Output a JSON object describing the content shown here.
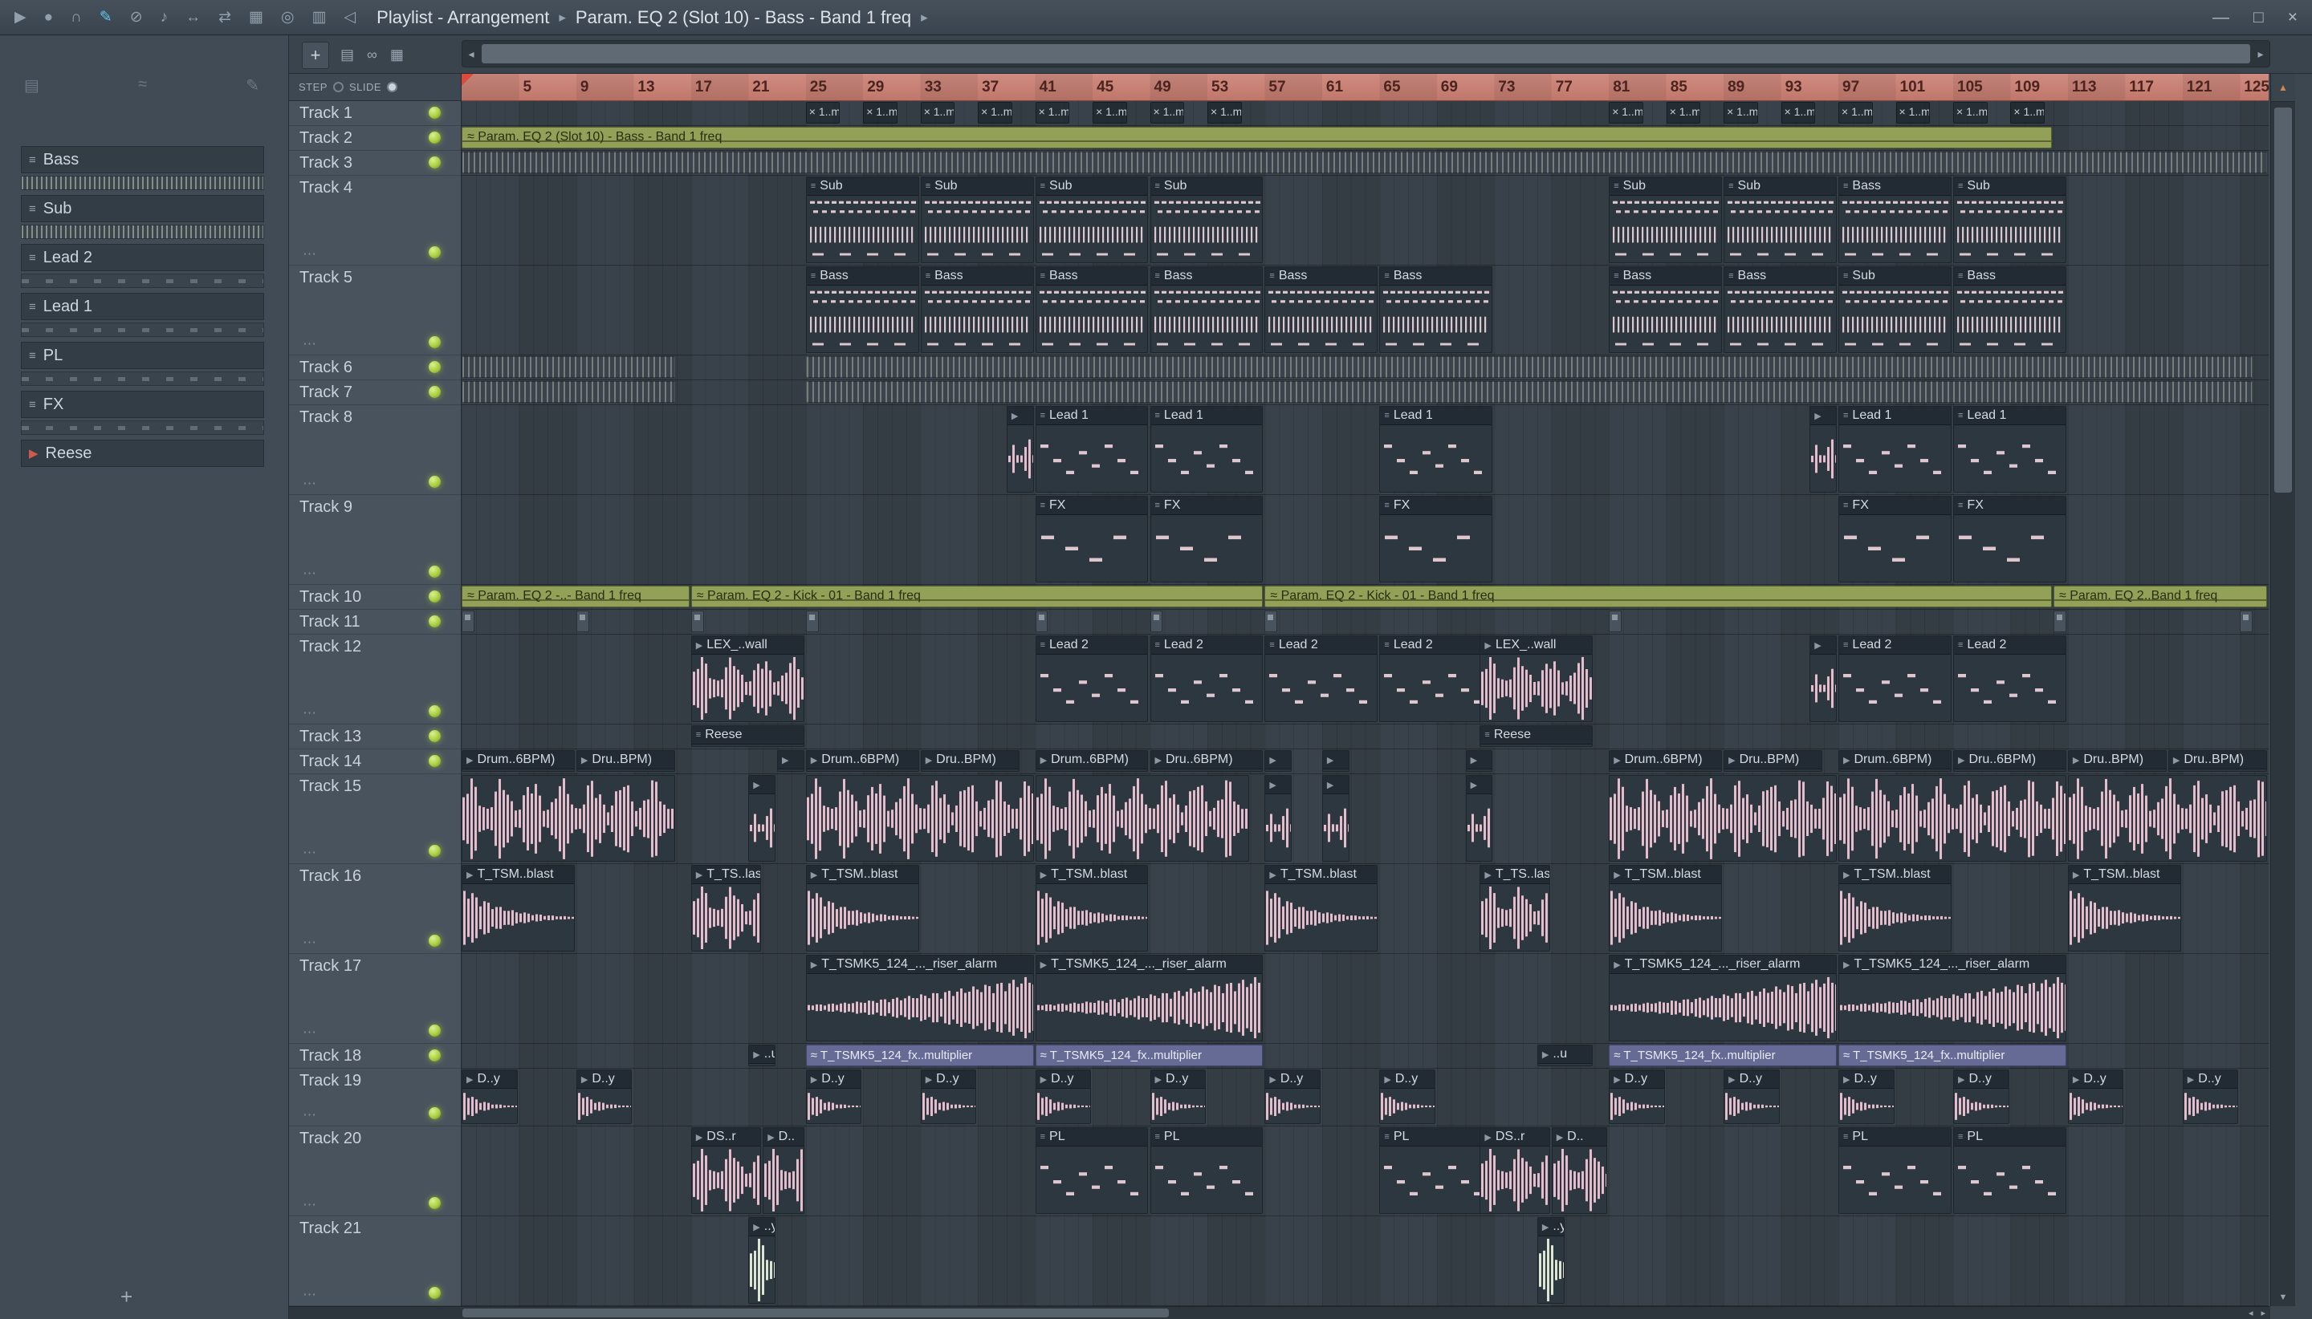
{
  "titlebar": {
    "sep": "▸",
    "part1": "Playlist - Arrangement",
    "part2": "Param. EQ 2 (Slot 10) - Bass - Band 1 freq",
    "window": {
      "minimize": "—",
      "maximize": "□",
      "close": "×"
    }
  },
  "toolbar_icons": [
    {
      "name": "play-icon",
      "glyph": "▶"
    },
    {
      "name": "record-icon",
      "glyph": "●"
    },
    {
      "name": "snap-icon",
      "glyph": "∩"
    },
    {
      "name": "draw-tool-icon",
      "glyph": "✎",
      "color": "#5fc7ec"
    },
    {
      "name": "disable-tool-icon",
      "glyph": "⊘"
    },
    {
      "name": "mute-tool-icon",
      "glyph": "♪"
    },
    {
      "name": "pan-tool-icon",
      "glyph": "↔"
    },
    {
      "name": "slip-tool-icon",
      "glyph": "⇄"
    },
    {
      "name": "select-tool-icon",
      "glyph": "▦"
    },
    {
      "name": "zoom-tool-icon",
      "glyph": "◎"
    },
    {
      "name": "preview-tool-icon",
      "glyph": "▥"
    },
    {
      "name": "playback-speaker-icon",
      "glyph": "◁"
    }
  ],
  "playlist_toolbar": {
    "add_label": "+",
    "icons": [
      {
        "name": "picker-icon",
        "glyph": "▤"
      },
      {
        "name": "link-icon",
        "glyph": "∞"
      },
      {
        "name": "grid-icon",
        "glyph": "▦"
      }
    ],
    "step_label": "STEP",
    "slide_label": "SLIDE"
  },
  "scroll": {
    "left": "◂",
    "right": "▸",
    "up": "▲",
    "down": "▼"
  },
  "ruler": {
    "first": 5,
    "last": 125,
    "step": 4
  },
  "misc": {
    "grip": "⋯"
  },
  "sidebar": {
    "header_icons": [
      {
        "name": "picker-view-icon",
        "glyph": "▤"
      },
      {
        "name": "picker-sound-icon",
        "glyph": "≈"
      },
      {
        "name": "picker-edit-icon",
        "glyph": "✎"
      }
    ],
    "items": [
      {
        "label": "Bass",
        "icon": "pattern-icon",
        "preview": "stripes"
      },
      {
        "label": "Sub",
        "icon": "pattern-icon",
        "preview": "stripes"
      },
      {
        "label": "Lead 2",
        "icon": "pattern-icon",
        "preview": "dashes"
      },
      {
        "label": "Lead 1",
        "icon": "pattern-icon",
        "preview": "dashes"
      },
      {
        "label": "PL",
        "icon": "pattern-icon",
        "preview": "dashes"
      },
      {
        "label": "FX",
        "icon": "pattern-icon",
        "preview": "dashes"
      },
      {
        "label": "Reese",
        "icon": "audio-icon",
        "preview": "none"
      }
    ],
    "add_label": "+"
  },
  "colors": {
    "automation_clip": "#93a058",
    "ruler": "#c9837a",
    "purple_clip": "#666b96",
    "wave_pink": "#e4bccb",
    "wave_pale": "#dde6d2",
    "note_pink": "#dec6ce",
    "led_green": "#a8cf3e"
  },
  "tracks": [
    {
      "name": "Track 1",
      "h": "s",
      "clips": [
        {
          "t": "minix",
          "l": 2.5,
          "label": "1..m",
          "starts": [
            25,
            29,
            33,
            37,
            41,
            45,
            49,
            53,
            81,
            85,
            89,
            93,
            97,
            101,
            105,
            109
          ]
        }
      ]
    },
    {
      "name": "Track 2",
      "h": "s",
      "clips": [
        {
          "t": "auto",
          "s": 1,
          "l": 111,
          "label": "Param. EQ 2 (Slot 10) - Bass - Band 1 freq"
        }
      ]
    },
    {
      "name": "Track 3",
      "h": "s",
      "clips": [
        {
          "t": "stripe",
          "s": 1,
          "l": 126
        }
      ]
    },
    {
      "name": "Track 4",
      "h": "t",
      "clips": [
        {
          "t": "pat",
          "s": 25,
          "l": 8,
          "label": "Sub",
          "v": "subbass"
        },
        {
          "t": "pat",
          "s": 33,
          "l": 8,
          "label": "Sub",
          "v": "subbass"
        },
        {
          "t": "pat",
          "s": 41,
          "l": 8,
          "label": "Sub",
          "v": "subbass"
        },
        {
          "t": "pat",
          "s": 49,
          "l": 8,
          "label": "Sub",
          "v": "subbass"
        },
        {
          "t": "pat",
          "s": 81,
          "l": 8,
          "label": "Sub",
          "v": "subbass"
        },
        {
          "t": "pat",
          "s": 89,
          "l": 8,
          "label": "Sub",
          "v": "subbass"
        },
        {
          "t": "pat",
          "s": 97,
          "l": 8,
          "label": "Bass",
          "v": "subbass"
        },
        {
          "t": "pat",
          "s": 105,
          "l": 8,
          "label": "Sub",
          "v": "subbass"
        }
      ]
    },
    {
      "name": "Track 5",
      "h": "t",
      "clips": [
        {
          "t": "pat",
          "s": 25,
          "l": 8,
          "label": "Bass",
          "v": "subbass"
        },
        {
          "t": "pat",
          "s": 33,
          "l": 8,
          "label": "Bass",
          "v": "subbass"
        },
        {
          "t": "pat",
          "s": 41,
          "l": 8,
          "label": "Bass",
          "v": "subbass"
        },
        {
          "t": "pat",
          "s": 49,
          "l": 8,
          "label": "Bass",
          "v": "subbass"
        },
        {
          "t": "pat",
          "s": 57,
          "l": 8,
          "label": "Bass",
          "v": "subbass"
        },
        {
          "t": "pat",
          "s": 65,
          "l": 8,
          "label": "Bass",
          "v": "subbass"
        },
        {
          "t": "pat",
          "s": 81,
          "l": 8,
          "label": "Bass",
          "v": "subbass"
        },
        {
          "t": "pat",
          "s": 89,
          "l": 8,
          "label": "Bass",
          "v": "subbass"
        },
        {
          "t": "pat",
          "s": 97,
          "l": 8,
          "label": "Sub",
          "v": "subbass"
        },
        {
          "t": "pat",
          "s": 105,
          "l": 8,
          "label": "Bass",
          "v": "subbass"
        }
      ]
    },
    {
      "name": "Track 6",
      "h": "s",
      "clips": [
        {
          "t": "stripe",
          "s": 1,
          "l": 15
        },
        {
          "t": "stripe",
          "s": 25,
          "l": 101
        }
      ]
    },
    {
      "name": "Track 7",
      "h": "s",
      "clips": [
        {
          "t": "stripe",
          "s": 1,
          "l": 15
        },
        {
          "t": "stripe",
          "s": 25,
          "l": 101
        }
      ]
    },
    {
      "name": "Track 8",
      "h": "t",
      "clips": [
        {
          "t": "aud",
          "s": 39,
          "l": 2,
          "w": "sparse"
        },
        {
          "t": "pat",
          "s": 41,
          "l": 8,
          "label": "Lead 1",
          "v": "steps"
        },
        {
          "t": "pat",
          "s": 49,
          "l": 8,
          "label": "Lead 1",
          "v": "steps"
        },
        {
          "t": "pat",
          "s": 65,
          "l": 8,
          "label": "Lead 1",
          "v": "steps"
        },
        {
          "t": "aud",
          "s": 95,
          "l": 2,
          "w": "sparse"
        },
        {
          "t": "pat",
          "s": 97,
          "l": 8,
          "label": "Lead 1",
          "v": "steps"
        },
        {
          "t": "pat",
          "s": 105,
          "l": 8,
          "label": "Lead 1",
          "v": "steps"
        }
      ]
    },
    {
      "name": "Track 9",
      "h": "t",
      "clips": [
        {
          "t": "pat",
          "s": 41,
          "l": 8,
          "label": "FX",
          "v": "fx"
        },
        {
          "t": "pat",
          "s": 49,
          "l": 8,
          "label": "FX",
          "v": "fx"
        },
        {
          "t": "pat",
          "s": 65,
          "l": 8,
          "label": "FX",
          "v": "fx"
        },
        {
          "t": "pat",
          "s": 97,
          "l": 8,
          "label": "FX",
          "v": "fx"
        },
        {
          "t": "pat",
          "s": 105,
          "l": 8,
          "label": "FX",
          "v": "fx"
        }
      ]
    },
    {
      "name": "Track 10",
      "h": "s",
      "clips": [
        {
          "t": "auto",
          "s": 1,
          "l": 16,
          "label": "Param. EQ 2 -..- Band 1 freq"
        },
        {
          "t": "auto",
          "s": 17,
          "l": 40,
          "label": "Param. EQ 2 - Kick - 01 - Band 1 freq"
        },
        {
          "t": "auto",
          "s": 57,
          "l": 55,
          "label": "Param. EQ 2 - Kick - 01 - Band 1 freq"
        },
        {
          "t": "auto",
          "s": 112,
          "l": 15,
          "label": "Param. EQ 2..Band 1 freq"
        }
      ]
    },
    {
      "name": "Track 11",
      "h": "s",
      "clips": [
        {
          "t": "mini",
          "l": 1,
          "starts": [
            1,
            9,
            17,
            25,
            41,
            49,
            57,
            81,
            112,
            125
          ]
        }
      ]
    },
    {
      "name": "Track 12",
      "h": "t",
      "clips": [
        {
          "t": "aud",
          "s": 17,
          "l": 8,
          "label": "LEX_..wall",
          "w": "dense"
        },
        {
          "t": "pat",
          "s": 41,
          "l": 8,
          "label": "Lead 2",
          "v": "steps"
        },
        {
          "t": "pat",
          "s": 49,
          "l": 8,
          "label": "Lead 2",
          "v": "steps"
        },
        {
          "t": "pat",
          "s": 57,
          "l": 8,
          "label": "Lead 2",
          "v": "steps"
        },
        {
          "t": "pat",
          "s": 65,
          "l": 8,
          "label": "Lead 2",
          "v": "steps"
        },
        {
          "t": "aud",
          "s": 72,
          "l": 8,
          "label": "LEX_..wall",
          "w": "dense"
        },
        {
          "t": "aud",
          "s": 95,
          "l": 2,
          "w": "sparse"
        },
        {
          "t": "pat",
          "s": 97,
          "l": 8,
          "label": "Lead 2",
          "v": "steps"
        },
        {
          "t": "pat",
          "s": 105,
          "l": 8,
          "label": "Lead 2",
          "v": "steps"
        }
      ]
    },
    {
      "name": "Track 13",
      "h": "s",
      "clips": [
        {
          "t": "pat",
          "s": 17,
          "l": 8,
          "label": "Reese",
          "v": "reese"
        },
        {
          "t": "pat",
          "s": 72,
          "l": 8,
          "label": "Reese",
          "v": "reese"
        }
      ]
    },
    {
      "name": "Track 14",
      "h": "s",
      "clips": [
        {
          "t": "aud",
          "s": 1,
          "l": 8,
          "label": "Drum..6BPM)"
        },
        {
          "t": "aud",
          "s": 9,
          "l": 7,
          "label": "Dru..BPM)"
        },
        {
          "t": "aud",
          "s": 23,
          "l": 2
        },
        {
          "t": "aud",
          "s": 25,
          "l": 8,
          "label": "Drum..6BPM)"
        },
        {
          "t": "aud",
          "s": 33,
          "l": 7,
          "label": "Dru..BPM)"
        },
        {
          "t": "aud",
          "s": 41,
          "l": 8,
          "label": "Drum..6BPM)"
        },
        {
          "t": "aud",
          "s": 49,
          "l": 8,
          "label": "Dru..6BPM)"
        },
        {
          "t": "aud",
          "s": 57,
          "l": 2
        },
        {
          "t": "aud",
          "s": 61,
          "l": 2
        },
        {
          "t": "aud",
          "s": 71,
          "l": 2
        },
        {
          "t": "aud",
          "s": 81,
          "l": 8,
          "label": "Drum..6BPM)"
        },
        {
          "t": "aud",
          "s": 89,
          "l": 7,
          "label": "Dru..BPM)"
        },
        {
          "t": "aud",
          "s": 97,
          "l": 8,
          "label": "Drum..6BPM)"
        },
        {
          "t": "aud",
          "s": 105,
          "l": 8,
          "label": "Dru..6BPM)"
        },
        {
          "t": "aud",
          "s": 113,
          "l": 7,
          "label": "Dru..BPM)"
        },
        {
          "t": "aud",
          "s": 120,
          "l": 7,
          "label": "Dru..BPM)"
        }
      ]
    },
    {
      "name": "Track 15",
      "h": "t",
      "clips": [
        {
          "t": "wave",
          "s": 1,
          "l": 15,
          "w": "dense"
        },
        {
          "t": "aud",
          "s": 21,
          "l": 2,
          "w": "sparse"
        },
        {
          "t": "wave",
          "s": 25,
          "l": 16,
          "w": "dense"
        },
        {
          "t": "wave",
          "s": 41,
          "l": 15,
          "w": "dense"
        },
        {
          "t": "aud",
          "s": 57,
          "l": 2,
          "w": "sparse"
        },
        {
          "t": "aud",
          "s": 61,
          "l": 2,
          "w": "sparse"
        },
        {
          "t": "aud",
          "s": 71,
          "l": 2,
          "w": "sparse"
        },
        {
          "t": "wave",
          "s": 81,
          "l": 16,
          "w": "dense"
        },
        {
          "t": "wave",
          "s": 97,
          "l": 16,
          "w": "dense"
        },
        {
          "t": "wave",
          "s": 113,
          "l": 14,
          "w": "dense"
        }
      ]
    },
    {
      "name": "Track 16",
      "h": "t",
      "clips": [
        {
          "t": "aud",
          "s": 1,
          "l": 8,
          "label": "T_TSM..blast",
          "w": "decay"
        },
        {
          "t": "aud",
          "s": 17,
          "l": 5,
          "label": "T_TS..last",
          "w": "dense"
        },
        {
          "t": "aud",
          "s": 25,
          "l": 8,
          "label": "T_TSM..blast",
          "w": "decay"
        },
        {
          "t": "aud",
          "s": 41,
          "l": 8,
          "label": "T_TSM..blast",
          "w": "decay"
        },
        {
          "t": "aud",
          "s": 57,
          "l": 8,
          "label": "T_TSM..blast",
          "w": "decay"
        },
        {
          "t": "aud",
          "s": 72,
          "l": 5,
          "label": "T_TS..last",
          "w": "dense"
        },
        {
          "t": "aud",
          "s": 81,
          "l": 8,
          "label": "T_TSM..blast",
          "w": "decay"
        },
        {
          "t": "aud",
          "s": 97,
          "l": 8,
          "label": "T_TSM..blast",
          "w": "decay"
        },
        {
          "t": "aud",
          "s": 113,
          "l": 8,
          "label": "T_TSM..blast",
          "w": "decay"
        }
      ]
    },
    {
      "name": "Track 17",
      "h": "t",
      "clips": [
        {
          "t": "aud",
          "s": 25,
          "l": 16,
          "label": "T_TSMK5_124_..._riser_alarm",
          "w": "riser"
        },
        {
          "t": "aud",
          "s": 41,
          "l": 16,
          "label": "T_TSMK5_124_..._riser_alarm",
          "w": "riser"
        },
        {
          "t": "aud",
          "s": 81,
          "l": 16,
          "label": "T_TSMK5_124_..._riser_alarm",
          "w": "riser"
        },
        {
          "t": "aud",
          "s": 97,
          "l": 16,
          "label": "T_TSMK5_124_..._riser_alarm",
          "w": "riser"
        }
      ]
    },
    {
      "name": "Track 18",
      "h": "s",
      "clips": [
        {
          "t": "aud",
          "s": 21,
          "l": 2,
          "label": "..u"
        },
        {
          "t": "purple",
          "s": 25,
          "l": 16,
          "label": "T_TSMK5_124_fx..multiplier"
        },
        {
          "t": "purple",
          "s": 41,
          "l": 16,
          "label": "T_TSMK5_124_fx..multiplier"
        },
        {
          "t": "aud",
          "s": 76,
          "l": 4,
          "label": "..u"
        },
        {
          "t": "purple",
          "s": 81,
          "l": 16,
          "label": "T_TSMK5_124_fx..multiplier"
        },
        {
          "t": "purple",
          "s": 97,
          "l": 16,
          "label": "T_TSMK5_124_fx..multiplier"
        }
      ]
    },
    {
      "name": "Track 19",
      "h": "m",
      "clips": [
        {
          "t": "aud",
          "l": 4,
          "label": "D..y",
          "w": "decay",
          "starts": [
            1,
            9,
            25,
            33,
            41,
            49,
            57,
            65,
            81,
            89,
            97,
            105,
            113,
            121
          ]
        }
      ]
    },
    {
      "name": "Track 20",
      "h": "t",
      "clips": [
        {
          "t": "aud",
          "s": 17,
          "l": 5,
          "label": "DS..r",
          "w": "dense"
        },
        {
          "t": "aud",
          "s": 22,
          "l": 3,
          "label": "D..",
          "w": "dense"
        },
        {
          "t": "pat",
          "s": 41,
          "l": 8,
          "label": "PL",
          "v": "steps"
        },
        {
          "t": "pat",
          "s": 49,
          "l": 8,
          "label": "PL",
          "v": "steps"
        },
        {
          "t": "pat",
          "s": 65,
          "l": 8,
          "label": "PL",
          "v": "steps"
        },
        {
          "t": "aud",
          "s": 72,
          "l": 5,
          "label": "DS..r",
          "w": "dense"
        },
        {
          "t": "aud",
          "s": 77,
          "l": 4,
          "label": "D..",
          "w": "dense"
        },
        {
          "t": "pat",
          "s": 97,
          "l": 8,
          "label": "PL",
          "v": "steps"
        },
        {
          "t": "pat",
          "s": 105,
          "l": 8,
          "label": "PL",
          "v": "steps"
        }
      ]
    },
    {
      "name": "Track 21",
      "h": "t",
      "clips": [
        {
          "t": "aud",
          "s": 21,
          "l": 2,
          "label": "..y",
          "w": "dense",
          "c": "#dde6d2"
        },
        {
          "t": "aud",
          "s": 76,
          "l": 2,
          "label": "..y",
          "w": "dense",
          "c": "#dde6d2"
        }
      ]
    }
  ]
}
